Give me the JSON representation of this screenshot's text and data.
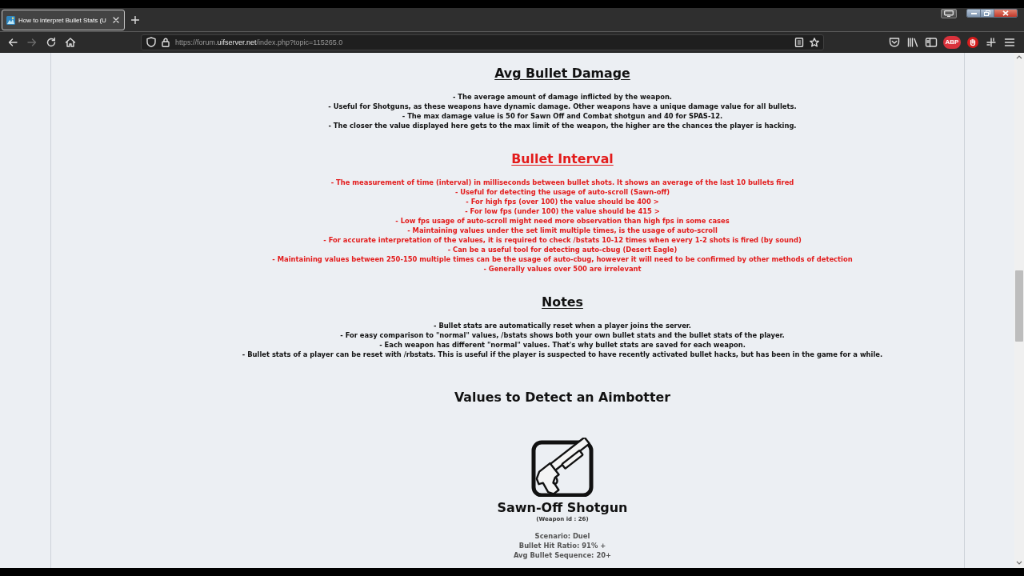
{
  "browser": {
    "tab": {
      "title": "How to interpret Bullet Stats (U",
      "selected": true
    },
    "forward_button": {
      "disabled": true
    },
    "address_bar": {
      "url_start": "https://forum.",
      "url_domain": "uifserver.net",
      "url_end": "/index.php?topic=115265.0"
    },
    "extension_badge": "ABP"
  },
  "sections": [
    {
      "heading": "Avg Bullet Damage",
      "color": "#111111",
      "lines": [
        "- The average amount of damage inflicted by the weapon.",
        "- Useful for Shotguns, as these weapons have dynamic damage. Other weapons have a unique damage value for all bullets.",
        "- The max damage value is 50 for Sawn Off and Combat shotgun and 40 for SPAS-12.",
        "- The closer the value displayed here gets to the max limit of the weapon, the higher are the chances the player is hacking."
      ]
    },
    {
      "heading": "Bullet Interval",
      "color": "#e31b1b",
      "lines": [
        "- The measurement of time (interval) in milliseconds between bullet shots. It shows an average of the last 10 bullets fired",
        "- Useful for detecting the usage of auto-scroll (Sawn-off)",
        "- For high fps (over 100) the value should be 400 >",
        "- For low fps (under 100) the value should be 415 >",
        "- Low fps usage of auto-scroll might need more observation than high fps in some cases",
        "- Maintaining values under the set limit multiple times, is the usage of auto-scroll",
        "- For accurate interpretation of the values, it is required to check /bstats 10-12 times when every 1-2 shots is fired (by sound)",
        "- Can be a useful tool for detecting auto-cbug (Desert Eagle)",
        "- Maintaining values between 250-150 multiple times can be the usage of auto-cbug, however it will need to be confirmed by other methods of detection",
        "- Generally values over 500 are irrelevant"
      ]
    },
    {
      "heading": "Notes",
      "color": "#111111",
      "lines": [
        "- Bullet stats are automatically reset when a player joins the server.",
        "- For easy comparison to \"normal\" values, /bstats shows both your own bullet stats and the bullet stats of the player.",
        "- Each weapon has different \"normal\" values. That's why bullet stats are saved for each weapon.",
        "- Bullet stats of a player can be reset with /rbstats. This is useful if the player is suspected to have recently activated bullet hacks, but has been in the game for a while."
      ]
    }
  ],
  "aimbot_values": {
    "heading": "Values to Detect an Aimbotter",
    "weapon": {
      "name": "Sawn-Off Shotgun",
      "id_label": "(Weapon id : 26)",
      "stats": [
        "Scenario: Duel",
        "Bullet Hit Ratio: 91% +",
        "Avg Bullet Sequence: 20+"
      ]
    }
  }
}
